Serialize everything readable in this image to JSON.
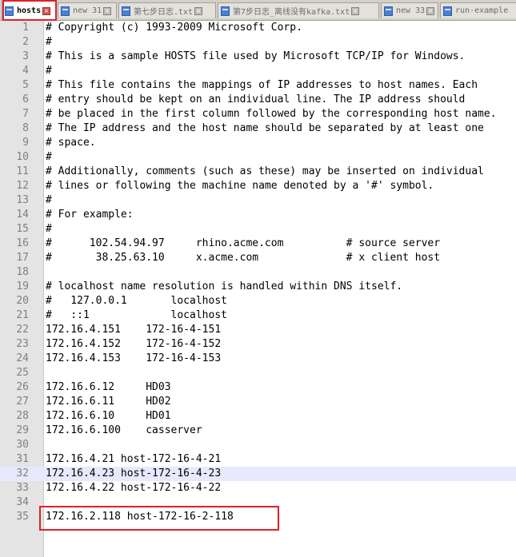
{
  "tabs": [
    {
      "label": "hosts",
      "active": true
    },
    {
      "label": "new 31",
      "active": false
    },
    {
      "label": "第七步日志.txt",
      "active": false
    },
    {
      "label": "第7步日志_离线没有kafka.txt",
      "active": false
    },
    {
      "label": "new 33",
      "active": false
    },
    {
      "label": "run-example",
      "active": false
    }
  ],
  "editor": {
    "current_line": 32,
    "lines": [
      "# Copyright (c) 1993-2009 Microsoft Corp.",
      "#",
      "# This is a sample HOSTS file used by Microsoft TCP/IP for Windows.",
      "#",
      "# This file contains the mappings of IP addresses to host names. Each",
      "# entry should be kept on an individual line. The IP address should",
      "# be placed in the first column followed by the corresponding host name.",
      "# The IP address and the host name should be separated by at least one",
      "# space.",
      "#",
      "# Additionally, comments (such as these) may be inserted on individual",
      "# lines or following the machine name denoted by a '#' symbol.",
      "#",
      "# For example:",
      "#",
      "#      102.54.94.97     rhino.acme.com          # source server",
      "#       38.25.63.10     x.acme.com              # x client host",
      "",
      "# localhost name resolution is handled within DNS itself.",
      "#   127.0.0.1       localhost",
      "#   ::1             localhost",
      "172.16.4.151    172-16-4-151",
      "172.16.4.152    172-16-4-152",
      "172.16.4.153    172-16-4-153",
      "",
      "172.16.6.12     HD03",
      "172.16.6.11     HD02",
      "172.16.6.10     HD01",
      "172.16.6.100    casserver",
      "",
      "172.16.4.21 host-172-16-4-21",
      "172.16.4.23 host-172-16-4-23",
      "172.16.4.22 host-172-16-4-22",
      "",
      "172.16.2.118 host-172-16-2-118"
    ]
  },
  "annotations": {
    "color": "#e0202a",
    "targets": [
      "hosts tab",
      "line 35"
    ]
  }
}
